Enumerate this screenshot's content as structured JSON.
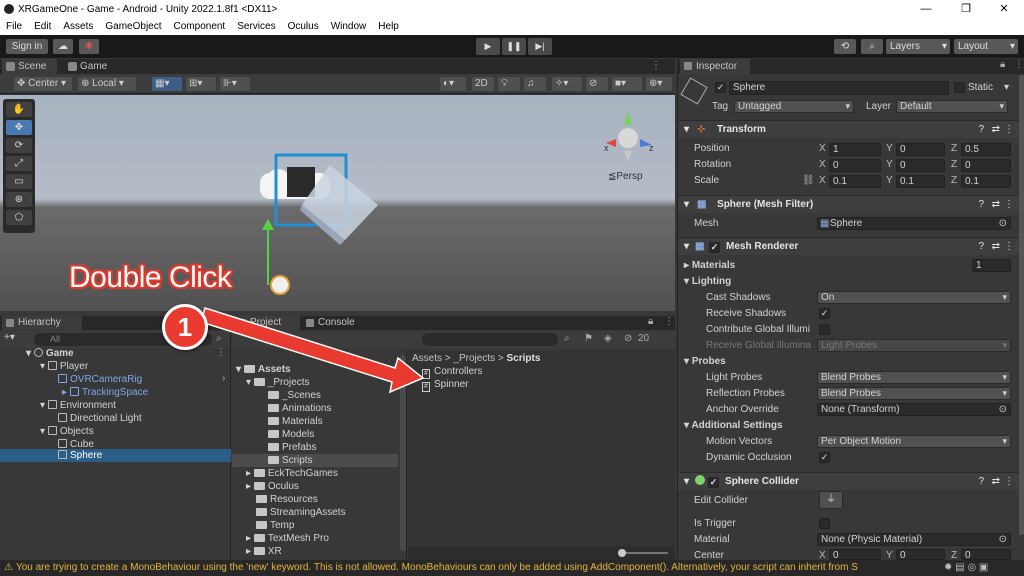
{
  "window": {
    "title": "XRGameOne - Game - Android - Unity 2022.1.8f1 <DX11>",
    "minimize_icon": "minimize-icon",
    "maximize_icon": "restore-icon",
    "close_icon": "close-icon"
  },
  "menu": {
    "items": [
      "File",
      "Edit",
      "Assets",
      "GameObject",
      "Component",
      "Services",
      "Oculus",
      "Window",
      "Help"
    ]
  },
  "toolbar": {
    "sign_in": "Sign in",
    "layers": "Layers",
    "layout": "Layout"
  },
  "scene": {
    "tabs": [
      "Scene",
      "Game"
    ],
    "pivot": "Center",
    "space": "Local",
    "mode_2d": "2D",
    "persp_label": "≦Persp",
    "gizmo_x": "x",
    "gizmo_z": "z"
  },
  "hierarchy": {
    "tab": "Hierarchy",
    "search_placeholder": "All",
    "scene_name": "Game",
    "items": [
      {
        "label": "Player"
      },
      {
        "label": "OVRCameraRig"
      },
      {
        "label": "TrackingSpace"
      },
      {
        "label": "Environment"
      },
      {
        "label": "Directional Light"
      },
      {
        "label": "Objects"
      },
      {
        "label": "Cube"
      },
      {
        "label": "Sphere"
      }
    ]
  },
  "project": {
    "tabs": [
      "Project",
      "Console"
    ],
    "layer_count": "20",
    "breadcrumb": {
      "a": "Assets",
      "b": "_Projects",
      "c": "Scripts",
      "sep": ">"
    },
    "tree": [
      "Assets",
      "_Projects",
      "_Scenes",
      "Animations",
      "Materials",
      "Models",
      "Prefabs",
      "Scripts",
      "EckTechGames",
      "Oculus",
      "Resources",
      "StreamingAssets",
      "Temp",
      "TextMesh Pro",
      "XR"
    ],
    "files": [
      "Controllers",
      "Spinner"
    ]
  },
  "inspector": {
    "tab": "Inspector",
    "object_name": "Sphere",
    "static_label": "Static",
    "tag_label": "Tag",
    "tag_value": "Untagged",
    "layer_label": "Layer",
    "layer_value": "Default",
    "transform": {
      "title": "Transform",
      "position_label": "Position",
      "rotation_label": "Rotation",
      "scale_label": "Scale",
      "position": [
        "1",
        "0",
        "0.5"
      ],
      "rotation": [
        "0",
        "0",
        "0"
      ],
      "scale": [
        "0.1",
        "0.1",
        "0.1"
      ],
      "x": "X",
      "y": "Y",
      "z": "Z"
    },
    "mesh_filter": {
      "title": "Sphere (Mesh Filter)",
      "mesh_label": "Mesh",
      "mesh_value": "Sphere"
    },
    "mesh_renderer": {
      "title": "Mesh Renderer",
      "materials_label": "Materials",
      "materials_count": "1",
      "lighting_label": "Lighting",
      "cast_shadows_label": "Cast Shadows",
      "cast_shadows_value": "On",
      "receive_shadows_label": "Receive Shadows",
      "contribute_gi_label": "Contribute Global Illumi",
      "receive_gi_label": "Receive Global Illumina",
      "receive_gi_value": "Light Probes",
      "probes_label": "Probes",
      "light_probes_label": "Light Probes",
      "light_probes_value": "Blend Probes",
      "reflection_probes_label": "Reflection Probes",
      "reflection_probes_value": "Blend Probes",
      "anchor_override_label": "Anchor Override",
      "anchor_override_value": "None (Transform)",
      "additional_label": "Additional Settings",
      "motion_vectors_label": "Motion Vectors",
      "motion_vectors_value": "Per Object Motion",
      "dynamic_occlusion_label": "Dynamic Occlusion"
    },
    "sphere_collider": {
      "title": "Sphere Collider",
      "edit_collider_label": "Edit Collider",
      "is_trigger_label": "Is Trigger",
      "material_label": "Material",
      "material_value": "None (Physic Material)",
      "center_label": "Center",
      "center": [
        "0",
        "0",
        "0"
      ]
    }
  },
  "status": {
    "message": "You are trying to create a MonoBehaviour using the 'new' keyword.  This is not allowed.  MonoBehaviours can only be added using AddComponent(). Alternatively, your script can inherit from S"
  },
  "annotation": {
    "label": "Double Click",
    "step": "1"
  },
  "colors": {
    "selection": "#2c5d87",
    "annotation_red": "#e83a2f",
    "warning": "#e7b43a",
    "prefab_blue": "#7da7e6"
  }
}
